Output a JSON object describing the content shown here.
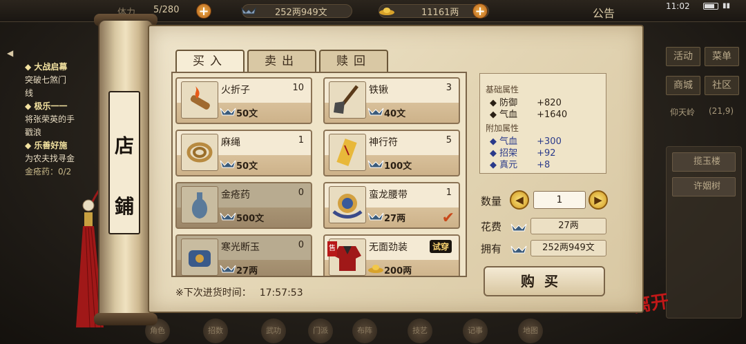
{
  "topbar": {
    "partial_label": "体力",
    "stamina": "5/280",
    "copper": "252两949文",
    "silver": "11161两",
    "notice": "公告",
    "time": "11:02"
  },
  "quests": [
    {
      "title": "大战启幕",
      "desc": [
        "突破七煞门",
        "线"
      ]
    },
    {
      "title": "极乐一一",
      "desc": [
        "将张荣英的手",
        "戳浪"
      ]
    },
    {
      "title": "乐善好施",
      "desc": [
        "为农夫找寻金",
        "金疮药：0/2"
      ]
    }
  ],
  "right_menu": {
    "buttons": [
      "活动",
      "菜单",
      "商城",
      "社区"
    ],
    "location": "仰天岭",
    "coords": "(21,9)",
    "list": [
      "揽玉楼",
      "许姻树"
    ],
    "leave": "离开"
  },
  "bottom_icons": [
    "角色",
    "招数",
    "武功",
    "门派",
    "布阵",
    "技艺",
    "记事",
    "地图"
  ],
  "shop": {
    "sign": [
      "店",
      "鋪"
    ],
    "tabs": [
      "买入",
      "卖出",
      "赎回"
    ],
    "active_tab": "买入",
    "items": [
      {
        "name": "火折子",
        "qty": "10",
        "price": "50文",
        "currency": "copper-coin-icon",
        "icon": "torch-icon"
      },
      {
        "name": "铁锹",
        "qty": "3",
        "price": "40文",
        "currency": "copper-coin-icon",
        "icon": "shovel-icon"
      },
      {
        "name": "麻绳",
        "qty": "1",
        "price": "50文",
        "currency": "copper-coin-icon",
        "icon": "rope-icon"
      },
      {
        "name": "神行符",
        "qty": "5",
        "price": "100文",
        "currency": "copper-coin-icon",
        "icon": "talisman-icon"
      },
      {
        "name": "金疮药",
        "qty": "0",
        "price": "500文",
        "currency": "copper-coin-icon",
        "icon": "medicine-bottle-icon"
      },
      {
        "name": "蛮龙腰带",
        "qty": "1",
        "price": "27两",
        "currency": "copper-coin-icon",
        "icon": "dragon-belt-icon"
      },
      {
        "name": "寒光断玉",
        "qty": "0",
        "price": "27两",
        "currency": "copper-coin-icon",
        "icon": "jade-pendant-icon"
      },
      {
        "name": "无面劲装",
        "tag": "试穿",
        "price": "200两",
        "currency": "gold-ingot-icon",
        "icon": "robe-icon"
      }
    ],
    "restock_label": "※下次进货时间：",
    "restock_time": "17:57:53",
    "attributes": {
      "base_title": "基础属性",
      "base": [
        {
          "label": "防御",
          "value": "+820"
        },
        {
          "label": "气血",
          "value": "+1640"
        }
      ],
      "extra_title": "附加属性",
      "extra": [
        {
          "label": "气血",
          "value": "+300"
        },
        {
          "label": "招架",
          "value": "+92"
        },
        {
          "label": "真元",
          "value": "+8"
        }
      ]
    },
    "quantity_label": "数量",
    "quantity": "1",
    "cost_label": "花费",
    "cost": "27两",
    "owned_label": "拥有",
    "owned": "252两949文",
    "buy_label": "购买"
  },
  "colors": {
    "paper": "#e9dcbc",
    "accent_red": "#c21818",
    "extra_attr": "#2a3a8a"
  }
}
